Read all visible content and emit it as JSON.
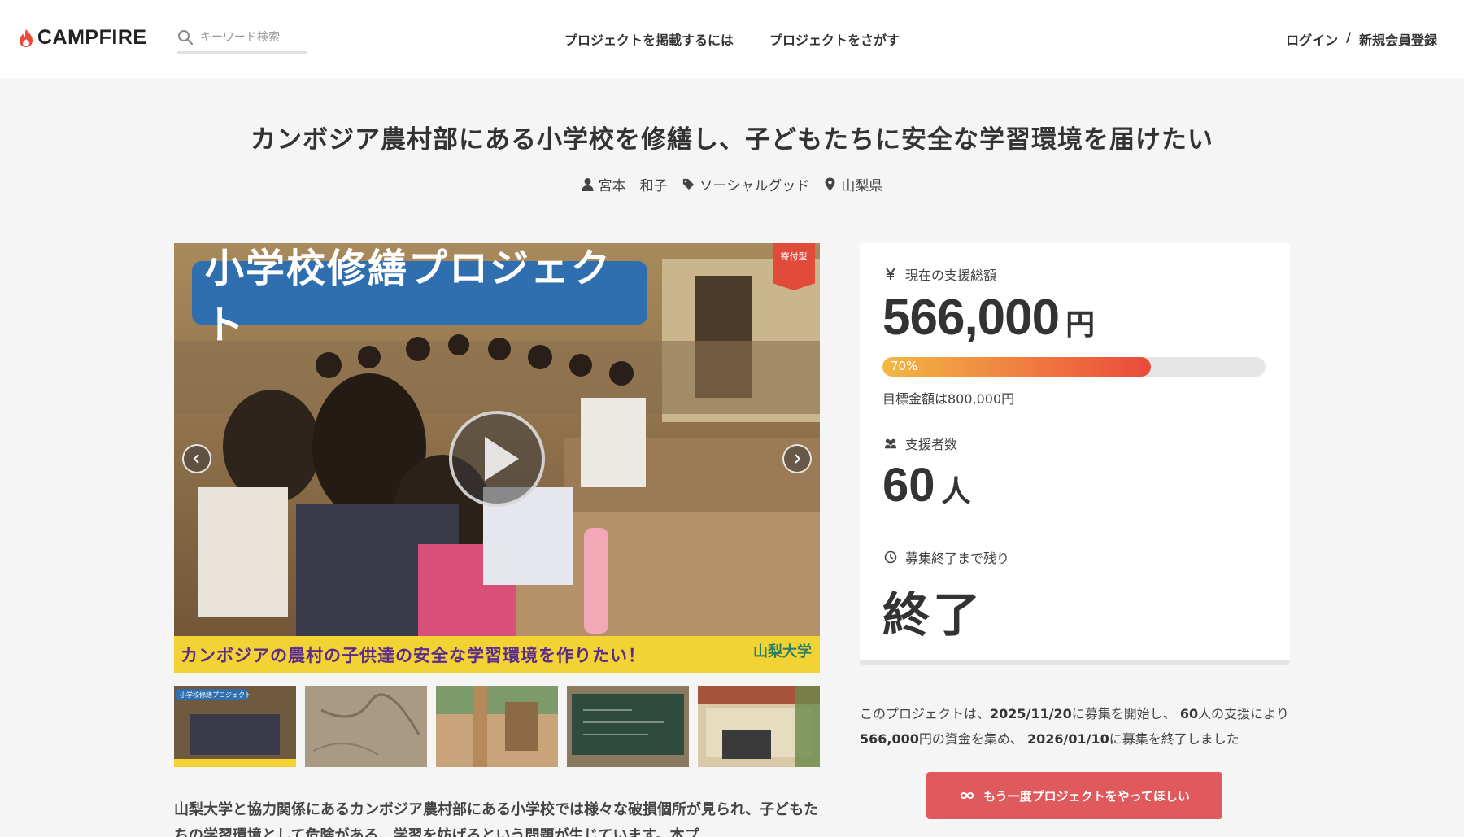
{
  "header": {
    "logo_text": "CAMPFIRE",
    "search_placeholder": "キーワード検索",
    "nav_post": "プロジェクトを掲載するには",
    "nav_find": "プロジェクトをさがす",
    "login": "ログイン",
    "separator": "/",
    "signup": "新規会員登録"
  },
  "project": {
    "title": "カンボジア農村部にある小学校を修繕し、子どもたちに安全な学習環境を届けたい",
    "owner": "宮本　和子",
    "category": "ソーシャルグッド",
    "location": "山梨県"
  },
  "media": {
    "banner_text": "小学校修繕プロジェクト",
    "caption": "カンボジアの農村の子供達の安全な学習環境を作りたい！",
    "university": "山梨大学",
    "badge": "寄付型",
    "thumb1_label": "小学校修繕プロジェクト"
  },
  "stats": {
    "total_label": "現在の支援総額",
    "amount": "566,000",
    "amount_unit": "円",
    "progress_percent": 70,
    "progress_text": "70%",
    "goal_text": "目標金額は800,000円",
    "backers_label": "支援者数",
    "backers": "60",
    "backers_unit": "人",
    "remaining_label": "募集終了まで残り",
    "remaining_value": "終了"
  },
  "summary": {
    "part1": "このプロジェクトは、",
    "start_date": "2025/11/20",
    "part2": "に募集を開始し、",
    "backers": "60",
    "part3": "人の支援により",
    "amount": "566,000",
    "part4": "円の資金を集め、",
    "end_date": "2026/01/10",
    "part5": "に募集を終了しました"
  },
  "cta_label": "もう一度プロジェクトをやってほしい",
  "description": "山梨大学と協力関係にあるカンボジア農村部にある小学校では様々な破損個所が見られ、子どもたちの学習環境として危険がある、学習を妨げるという問題が生じています。本プ",
  "colors": {
    "brand": "#e0595c",
    "banner_blue": "#2f6fb0",
    "strip_yellow": "#f3d233"
  }
}
